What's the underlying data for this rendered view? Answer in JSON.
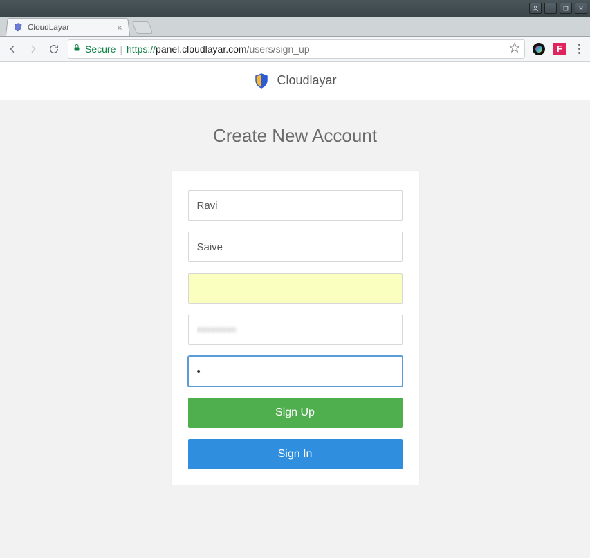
{
  "window": {
    "controls": [
      "user",
      "minimize",
      "maximize",
      "close"
    ]
  },
  "tab": {
    "title": "CloudLayar"
  },
  "addressbar": {
    "secure_label": "Secure",
    "proto": "https://",
    "host": "panel.cloudlayar.com",
    "path": "/users/sign_up"
  },
  "brand": {
    "name": "Cloudlayar"
  },
  "page": {
    "title": "Create New Account"
  },
  "form": {
    "first_name": "Ravi",
    "last_name": "Saive",
    "email": "",
    "password": "",
    "password_confirm": "",
    "submit_label": "Sign Up",
    "signin_label": "Sign In"
  }
}
